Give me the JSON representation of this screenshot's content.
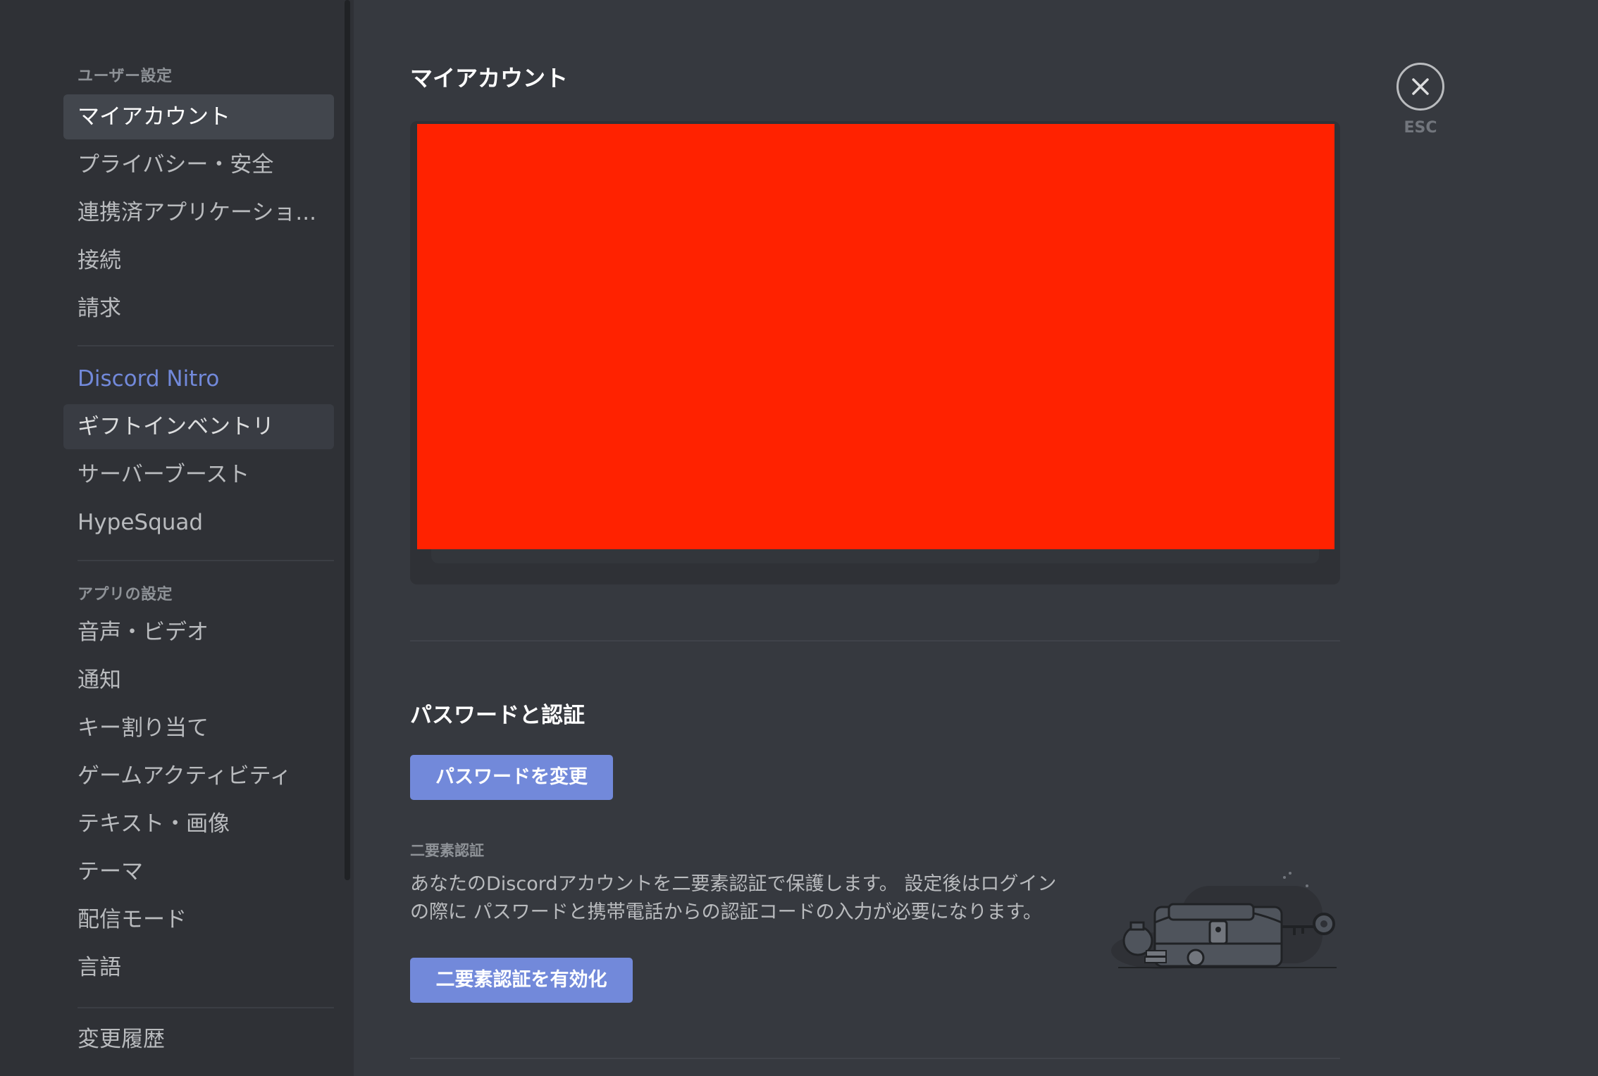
{
  "sidebar": {
    "user_settings_header": "ユーザー設定",
    "user_items": [
      {
        "label": "マイアカウント"
      },
      {
        "label": "プライバシー・安全"
      },
      {
        "label": "連携済アプリケーショ..."
      },
      {
        "label": "接続"
      },
      {
        "label": "請求"
      }
    ],
    "nitro_items": [
      {
        "label": "Discord Nitro"
      },
      {
        "label": "ギフトインベントリ"
      },
      {
        "label": "サーバーブースト"
      },
      {
        "label": "HypeSquad"
      }
    ],
    "app_settings_header": "アプリの設定",
    "app_items": [
      {
        "label": "音声・ビデオ"
      },
      {
        "label": "通知"
      },
      {
        "label": "キー割り当て"
      },
      {
        "label": "ゲームアクティビティ"
      },
      {
        "label": "テキスト・画像"
      },
      {
        "label": "テーマ"
      },
      {
        "label": "配信モード"
      },
      {
        "label": "言語"
      }
    ],
    "changelog_label": "変更履歴"
  },
  "main": {
    "title": "マイアカウント",
    "password_section_title": "パスワードと認証",
    "change_password_button": "パスワードを変更",
    "tfa_label": "二要素認証",
    "tfa_description_line1": "あなたのDiscordアカウントを二要素認証で保護します。 設定後はログイン",
    "tfa_description_line2": "の際に パスワードと携帯電話からの認証コードの入力が必要になります。",
    "enable_tfa_button": "二要素認証を有効化"
  },
  "close": {
    "esc_label": "ESC"
  },
  "colors": {
    "accent": "#7289da",
    "background": "#36393f",
    "sidebar": "#2f3136",
    "redacted": "#ff2200"
  }
}
